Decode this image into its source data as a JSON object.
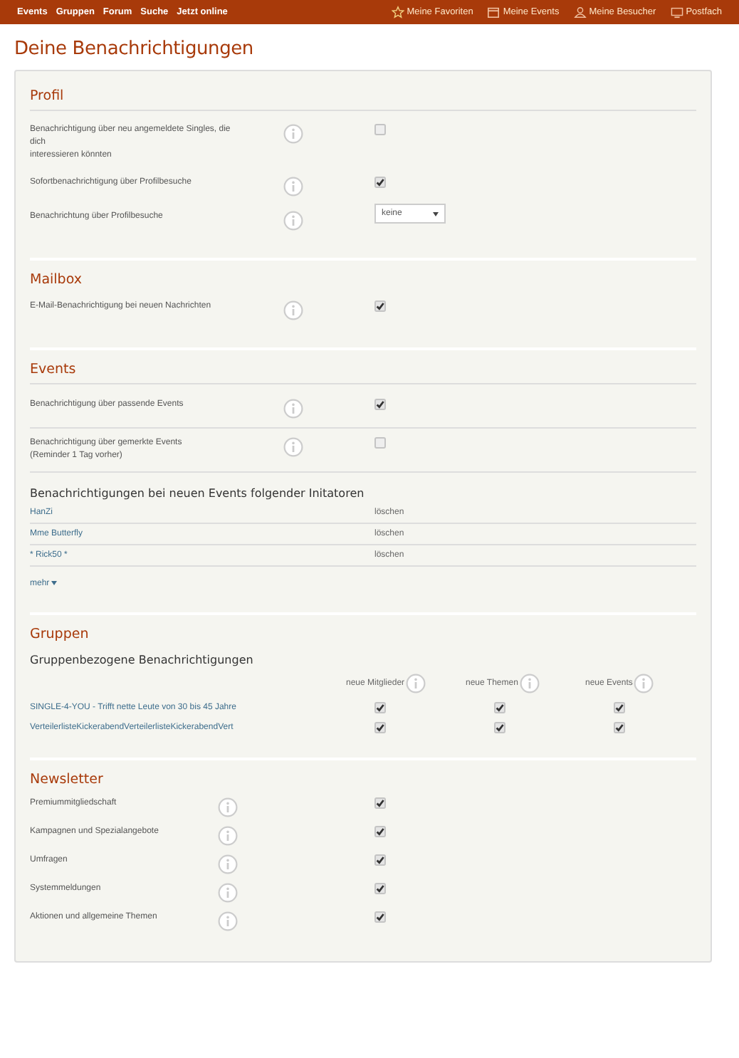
{
  "nav": {
    "left": [
      "Events",
      "Gruppen",
      "Forum",
      "Suche",
      "Jetzt online"
    ],
    "right": [
      "Meine Favoriten",
      "Meine Events",
      "Meine Besucher",
      "Postfach"
    ]
  },
  "title": "Deine Benachrichtigungen",
  "sections": [
    {
      "kind": "settings",
      "heading": "Profil",
      "rows": [
        {
          "kind": "checkbox",
          "label": "Benachrichtigung über neu angemeldete Singles, die\ndich\ninteressieren könnten",
          "checked": false
        },
        {
          "kind": "checkbox",
          "label": "Sofortbenachrichtigung über Profilbesuche",
          "checked": true
        },
        {
          "kind": "select",
          "label": "Benachrichtung über Profilbesuche",
          "value": "keine"
        }
      ]
    },
    {
      "kind": "settings",
      "heading": "Mailbox",
      "rows": [
        {
          "kind": "checkbox",
          "label": "E-Mail-Benachrichtigung bei neuen Nachrichten",
          "checked": true
        }
      ]
    },
    {
      "kind": "settings",
      "heading": "Events",
      "rows": [
        {
          "kind": "checkbox",
          "label": "Benachrichtigung über passende Events",
          "checked": true
        },
        {
          "kind": "checkbox",
          "label": "Benachrichtigung über gemerkte Events\n(Reminder 1 Tag vorher)",
          "checked": false
        }
      ],
      "initiators": {
        "heading": "Benachrichtigungen bei neuen Events folgender Initatoren",
        "items": [
          {
            "name": "HanZi",
            "action": "löschen"
          },
          {
            "name": "Mme Butterfly",
            "action": "löschen"
          },
          {
            "name": "* Rick50 *",
            "action": "löschen"
          }
        ],
        "more": "mehr"
      }
    },
    {
      "kind": "groups",
      "heading": "Gruppen",
      "subheading": "Gruppenbezogene Benachrichtigungen",
      "columns": [
        "neue Mitglieder",
        "neue Themen",
        "neue Events"
      ],
      "rows": [
        {
          "name": "SINGLE-4-YOU - Trifft nette Leute von 30 bis 45 Jahre",
          "cells": [
            {
              "checked": true
            },
            {
              "checked": true
            },
            {
              "checked": true
            }
          ]
        },
        {
          "name": "VerteilerlisteKickerabendVerteilerlisteKickerabendVert",
          "cells": [
            {
              "checked": true
            },
            {
              "checked": true
            },
            {
              "checked": true
            }
          ]
        }
      ]
    },
    {
      "kind": "newsletter",
      "heading": "Newsletter",
      "rows": [
        {
          "kind": "checkbox",
          "label": "Premiummitgliedschaft",
          "checked": true
        },
        {
          "kind": "checkbox",
          "label": "Kampagnen und Spezialangebote",
          "checked": true
        },
        {
          "kind": "checkbox",
          "label": "Umfragen",
          "checked": true
        },
        {
          "kind": "checkbox",
          "label": "Systemmeldungen",
          "checked": true
        },
        {
          "kind": "checkbox",
          "label": "Aktionen und allgemeine Themen",
          "checked": true
        }
      ]
    }
  ]
}
